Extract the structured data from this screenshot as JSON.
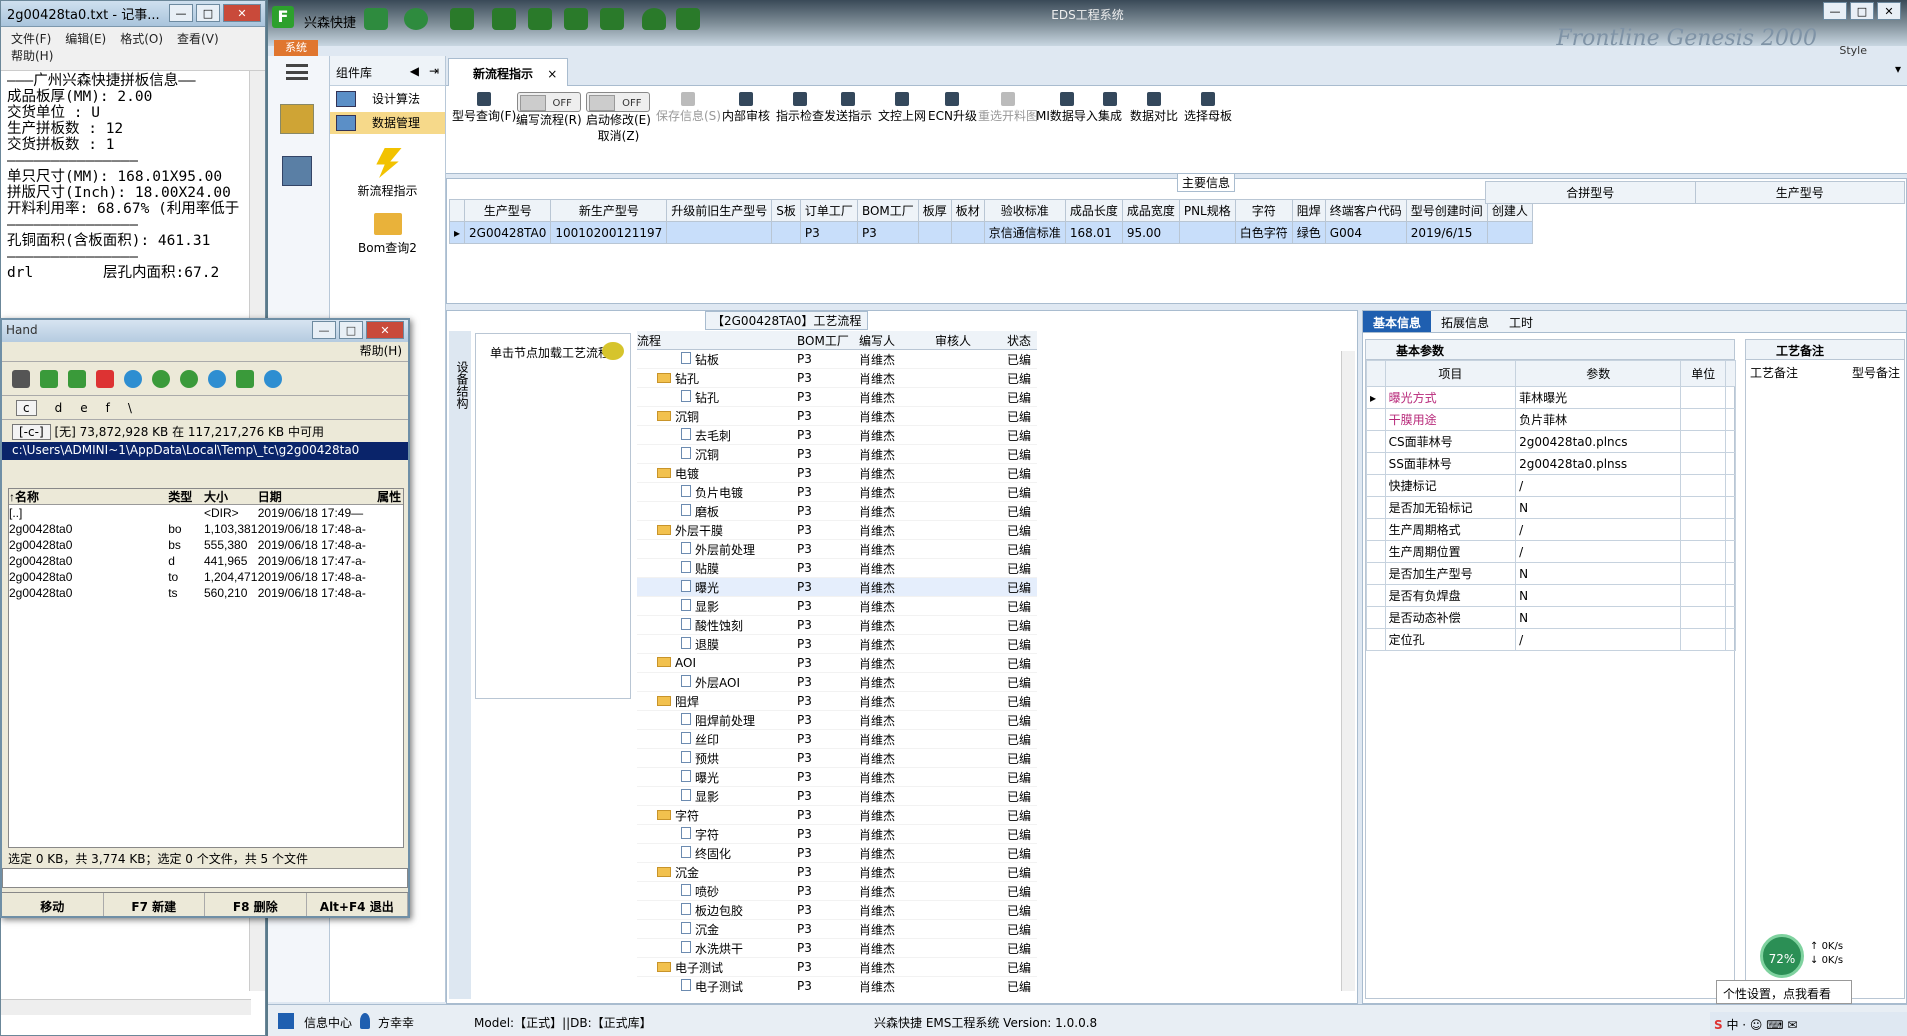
{
  "notepad": {
    "title": "2g00428ta0.txt - 记事...",
    "menu": [
      "文件(F)",
      "编辑(E)",
      "格式(O)",
      "查看(V)",
      "帮助(H)"
    ],
    "text": "———广州兴森快捷拼板信息——\n成品板厚(MM): 2.00\n交货单位 : U\n生产拼板数 : 12\n交货拼板数 : 1\n———————————————\n单只尺寸(MM): 168.01X95.00\n拼版尺寸(Inch): 18.00X24.00\n开料利用率: 68.67% (利用率低于\n———————————————\n孔铜面积(含板面积): 461.31\n———————————————\ndrl        层孔内面积:67.2"
  },
  "tc": {
    "title": "Hand",
    "menu": "帮助(H)",
    "drives": [
      "c",
      "d",
      "e",
      "f",
      "\\"
    ],
    "drive_sel": "[-c-]",
    "space": "[无]  73,872,928 KB 在 117,217,276 KB 中可用",
    "path": "c:\\Users\\ADMINI~1\\AppData\\Local\\Temp\\_tc\\g2g00428ta0",
    "cols": [
      "↑名称",
      "类型",
      "大小",
      "日期",
      "属性"
    ],
    "rows": [
      {
        "name": "[..]",
        "type": "",
        "size": "<DIR>",
        "date": "2019/06/18 17:49—",
        "attr": ""
      },
      {
        "name": "2g00428ta0",
        "type": "bo",
        "size": "1,103,381",
        "date": "2019/06/18 17:48-a-",
        "attr": ""
      },
      {
        "name": "2g00428ta0",
        "type": "bs",
        "size": "555,380",
        "date": "2019/06/18 17:48-a-",
        "attr": ""
      },
      {
        "name": "2g00428ta0",
        "type": "d",
        "size": "441,965",
        "date": "2019/06/18 17:47-a-",
        "attr": ""
      },
      {
        "name": "2g00428ta0",
        "type": "to",
        "size": "1,204,471",
        "date": "2019/06/18 17:48-a-",
        "attr": ""
      },
      {
        "name": "2g00428ta0",
        "type": "ts",
        "size": "560,210",
        "date": "2019/06/18 17:48-a-",
        "attr": ""
      }
    ],
    "status": "选定 0 KB，共 3,774 KB；选定 0 个文件，共 5 个文件",
    "fkeys": [
      "移动",
      "F7 新建",
      "F8 删除",
      "Alt+F4 退出"
    ]
  },
  "app": {
    "title": "EDS工程系统",
    "name": "兴森快捷",
    "system_btn": "系统",
    "brand": "Frontline Genesis 2000",
    "style": "Style",
    "component_lib": "组件库",
    "lib_items": [
      "设计算法",
      "数据管理"
    ],
    "big_items": [
      "新流程指示",
      "Bom查询2"
    ],
    "tab": "新流程指示",
    "ribbon": [
      {
        "label": "型号查询(F)",
        "dis": false
      },
      {
        "label": "编写流程(R)",
        "dis": false,
        "toggle": "OFF"
      },
      {
        "label": "启动修改(E)",
        "dis": false,
        "toggle": "OFF",
        "sub": "取消(Z)"
      },
      {
        "label": "保存信息(S)",
        "dis": true
      },
      {
        "label": "内部审核",
        "dis": false
      },
      {
        "label": "指示检查",
        "dis": false
      },
      {
        "label": "发送指示",
        "dis": false
      },
      {
        "label": "文控上网",
        "dis": false
      },
      {
        "label": "ECN升级",
        "dis": false
      },
      {
        "label": "重选开料图",
        "dis": true
      },
      {
        "label": "MI数据导入",
        "dis": false
      },
      {
        "label": "集成",
        "dis": false
      },
      {
        "label": "数据对比",
        "dis": false
      },
      {
        "label": "选择母板",
        "dis": false
      }
    ],
    "main_info_label": "主要信息",
    "main_cols": [
      "生产型号",
      "新生产型号",
      "升级前旧生产型号",
      "S板",
      "订单工厂",
      "BOM工厂",
      "板厚",
      "板材",
      "验收标准",
      "成品长度",
      "成品宽度",
      "PNL规格",
      "字符",
      "阻焊",
      "终端客户代码",
      "型号创建时间",
      "创建人"
    ],
    "main_row": [
      "2G00428TA0",
      "10010200121197",
      "",
      "",
      "P3",
      "P3",
      "",
      "",
      "京信通信标准",
      "168.01",
      "95.00",
      "",
      "白色字符",
      "绿色",
      "G004",
      "2019/6/15",
      ""
    ],
    "side_cols": [
      "合拼型号",
      "生产型号"
    ],
    "proc_title": "【2G00428TA0】工艺流程",
    "proc_side": "设备结构",
    "proc_hint": "单击节点加载工艺流程",
    "tree_cols": [
      "流程",
      "BOM工厂",
      "编写人",
      "审核人",
      "状态"
    ],
    "tree": [
      {
        "lvl": 1,
        "f": false,
        "name": "钻板"
      },
      {
        "lvl": 0,
        "f": true,
        "name": "钻孔"
      },
      {
        "lvl": 1,
        "f": false,
        "name": "钻孔"
      },
      {
        "lvl": 0,
        "f": true,
        "name": "沉铜"
      },
      {
        "lvl": 1,
        "f": false,
        "name": "去毛刺"
      },
      {
        "lvl": 1,
        "f": false,
        "name": "沉铜"
      },
      {
        "lvl": 0,
        "f": true,
        "name": "电镀"
      },
      {
        "lvl": 1,
        "f": false,
        "name": "负片电镀"
      },
      {
        "lvl": 1,
        "f": false,
        "name": "磨板"
      },
      {
        "lvl": 0,
        "f": true,
        "name": "外层干膜"
      },
      {
        "lvl": 1,
        "f": false,
        "name": "外层前处理"
      },
      {
        "lvl": 1,
        "f": false,
        "name": "贴膜"
      },
      {
        "lvl": 1,
        "f": false,
        "name": "曝光",
        "hl": true
      },
      {
        "lvl": 1,
        "f": false,
        "name": "显影"
      },
      {
        "lvl": 1,
        "f": false,
        "name": "酸性蚀刻"
      },
      {
        "lvl": 1,
        "f": false,
        "name": "退膜"
      },
      {
        "lvl": 0,
        "f": true,
        "name": "AOI"
      },
      {
        "lvl": 1,
        "f": false,
        "name": "外层AOI"
      },
      {
        "lvl": 0,
        "f": true,
        "name": "阻焊"
      },
      {
        "lvl": 1,
        "f": false,
        "name": "阻焊前处理"
      },
      {
        "lvl": 1,
        "f": false,
        "name": "丝印"
      },
      {
        "lvl": 1,
        "f": false,
        "name": "预烘"
      },
      {
        "lvl": 1,
        "f": false,
        "name": "曝光"
      },
      {
        "lvl": 1,
        "f": false,
        "name": "显影"
      },
      {
        "lvl": 0,
        "f": true,
        "name": "字符"
      },
      {
        "lvl": 1,
        "f": false,
        "name": "字符"
      },
      {
        "lvl": 1,
        "f": false,
        "name": "终固化"
      },
      {
        "lvl": 0,
        "f": true,
        "name": "沉金"
      },
      {
        "lvl": 1,
        "f": false,
        "name": "喷砂"
      },
      {
        "lvl": 1,
        "f": false,
        "name": "板边包胶"
      },
      {
        "lvl": 1,
        "f": false,
        "name": "沉金"
      },
      {
        "lvl": 1,
        "f": false,
        "name": "水洗烘干"
      },
      {
        "lvl": 0,
        "f": true,
        "name": "电子测试"
      },
      {
        "lvl": 1,
        "f": false,
        "name": "电子测试"
      }
    ],
    "tree_factory": "P3",
    "tree_writer": "肖维杰",
    "tree_status": "已编",
    "detail_tabs": [
      "基本信息",
      "拓展信息",
      "工时"
    ],
    "basic_label": "基本参数",
    "basic_cols": [
      "项目",
      "参数",
      "单位"
    ],
    "basic_rows": [
      {
        "k": "曝光方式",
        "v": "菲林曝光",
        "pink": true
      },
      {
        "k": "干膜用途",
        "v": "负片菲林",
        "pink": true
      },
      {
        "k": "CS面菲林号",
        "v": "2g00428ta0.plncs"
      },
      {
        "k": "SS面菲林号",
        "v": "2g00428ta0.plnss"
      },
      {
        "k": "快捷标记",
        "v": "/"
      },
      {
        "k": "是否加无铅标记",
        "v": "N"
      },
      {
        "k": "生产周期格式",
        "v": "/"
      },
      {
        "k": "生产周期位置",
        "v": "/"
      },
      {
        "k": "是否加生产型号",
        "v": "N"
      },
      {
        "k": "是否有负焊盘",
        "v": "N"
      },
      {
        "k": "是否动态补偿",
        "v": "N"
      },
      {
        "k": "定位孔",
        "v": "/"
      }
    ],
    "note_label": "工艺备注",
    "note_cols": [
      "工艺备注",
      "型号备注"
    ],
    "footer": {
      "info": "信息中心",
      "user": "方幸幸",
      "model": "Model:【正式】||DB:【正式库】",
      "version": "兴森快捷  EMS工程系统  Version: 1.0.0.8"
    }
  },
  "tray": {
    "percent": "72%",
    "up": "0K/s",
    "down": "0K/s",
    "tip": "个性设置，点我看看"
  }
}
